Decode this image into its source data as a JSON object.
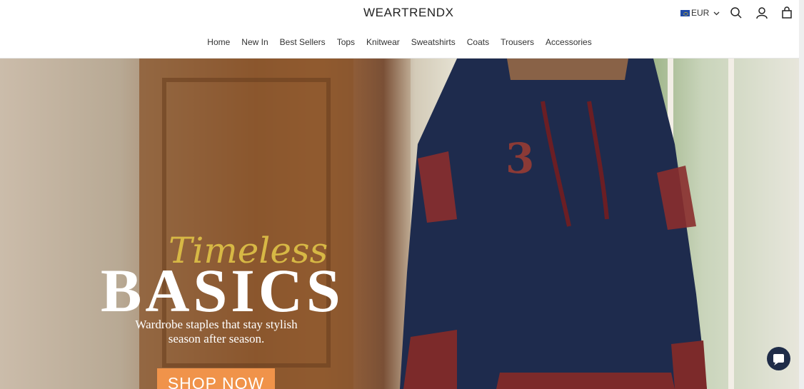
{
  "brand": {
    "logo_text": "WEARTRENDX"
  },
  "header": {
    "currency": "EUR",
    "icons": [
      "search-icon",
      "account-icon",
      "cart-icon"
    ]
  },
  "nav": {
    "items": [
      {
        "label": "Home"
      },
      {
        "label": "New In"
      },
      {
        "label": "Best Sellers"
      },
      {
        "label": "Tops"
      },
      {
        "label": "Knitwear"
      },
      {
        "label": "Sweatshirts"
      },
      {
        "label": "Coats"
      },
      {
        "label": "Trousers"
      },
      {
        "label": "Accessories"
      }
    ]
  },
  "hero": {
    "script_title": "Timeless",
    "title": "BASICS",
    "subtitle_line1": "Wardrobe staples that stay stylish",
    "subtitle_line2": "season after season.",
    "cta": "SHOP NOW"
  },
  "colors": {
    "cta_bg": "#f0934a",
    "script_gold": "#d7b845",
    "chat_bg": "#1f2c48"
  }
}
